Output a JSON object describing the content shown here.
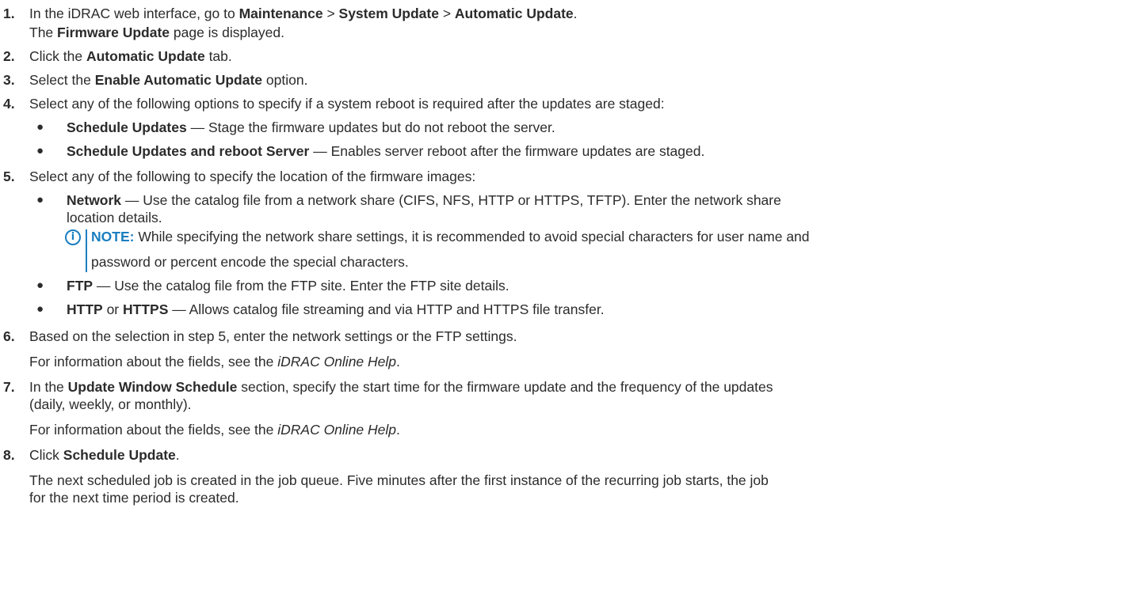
{
  "steps": [
    {
      "num": "1.",
      "a": "In the iDRAC web interface, go to ",
      "b1": "Maintenance",
      "a2": " > ",
      "b2": "System Update",
      "a3": " > ",
      "b3": "Automatic Update",
      "a4": ".",
      "line2_b": "Firmware Update",
      "line2_pre": "The ",
      "line2_post": " page is displayed."
    },
    {
      "num": "2.",
      "pre": "Click the ",
      "bold": "Automatic Update",
      "post": " tab."
    },
    {
      "num": "3.",
      "pre": "Select the ",
      "bold": "Enable Automatic Update",
      "post": " option."
    },
    {
      "num": "4.",
      "text": "Select any of the following options to specify if a system reboot is required after the updates are staged:",
      "bullets": [
        {
          "bold": "Schedule Updates",
          "text": " — Stage the firmware updates but do not reboot the server."
        },
        {
          "bold": "Schedule Updates and reboot Server",
          "text": " — Enables server reboot after the firmware updates are staged."
        }
      ]
    },
    {
      "num": "5.",
      "text": "Select any of the following to specify the location of the firmware images:",
      "bullets": [
        {
          "bold": "Network",
          "text": " — Use the catalog file from a network share (CIFS, NFS, HTTP or HTTPS, TFTP). Enter the network share",
          "cont": "location details."
        },
        {
          "bold": "FTP",
          "text": " — Use the catalog file from the FTP site. Enter the FTP site details."
        },
        {
          "bold": "HTTP",
          "mid": " or ",
          "bold2": "HTTPS",
          "text": " — Allows catalog file streaming and via HTTP and HTTPS file transfer."
        }
      ],
      "note": {
        "icon": "i",
        "label": "NOTE:",
        "line1": " While specifying the network share settings, it is recommended to avoid special characters for user name and",
        "line2": "password or percent encode the special characters."
      }
    },
    {
      "num": "6.",
      "text": "Based on the selection in step 5, enter the network settings or the FTP settings.",
      "info_pre": "For information about the fields, see the ",
      "info_i": "iDRAC Online Help",
      "info_post": "."
    },
    {
      "num": "7.",
      "pre": "In the ",
      "bold": "Update Window Schedule",
      "post": " section, specify the start time for the firmware update and the frequency of the updates",
      "cont": "(daily, weekly, or monthly).",
      "info_pre": "For information about the fields, see the ",
      "info_i": "iDRAC Online Help",
      "info_post": "."
    },
    {
      "num": "8.",
      "pre": "Click ",
      "bold": "Schedule Update",
      "post": ".",
      "p1": "The next scheduled job is created in the job queue. Five minutes after the first instance of the recurring job starts, the job",
      "p2": "for the next time period is created."
    }
  ],
  "colors": {
    "text": "#2b2b2b",
    "note_accent": "#1a7ec0"
  },
  "icons": {
    "bullet": "●",
    "note": "info-circle-icon"
  }
}
